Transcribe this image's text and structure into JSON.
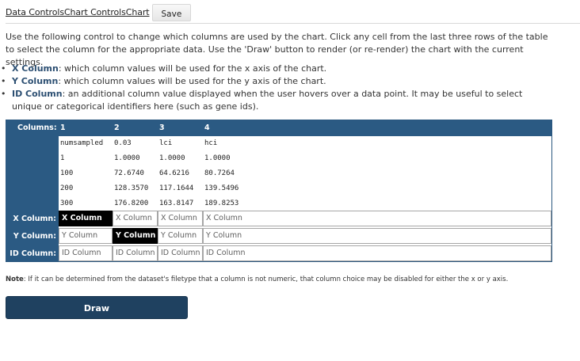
{
  "header": {
    "tab_label": "Data ControlsChart ControlsChart",
    "save_label": "Save"
  },
  "intro": "Use the following control to change which columns are used by the chart. Click any cell from the last three rows of the table to select the column for the appropriate data. Use the 'Draw' button to render (or re-render) the chart with the current settings.",
  "definitions": [
    {
      "term": "X Column",
      "text": ": which column values will be used for the x axis of the chart."
    },
    {
      "term": "Y Column",
      "text": ": which column values will be used for the y axis of the chart."
    },
    {
      "term": "ID Column",
      "text": ": an additional column value displayed when the user hovers over a data point. It may be useful to select unique or categorical identifiers here (such as gene ids)."
    }
  ],
  "table": {
    "columns_label": "Columns:",
    "column_numbers": [
      "1",
      "2",
      "3",
      "4"
    ],
    "data_rows": [
      [
        "numsampled",
        "0.03",
        "lci",
        "hci"
      ],
      [
        "1",
        "1.0000",
        "1.0000",
        "1.0000"
      ],
      [
        "100",
        "72.6740",
        "64.6216",
        "80.7264"
      ],
      [
        "200",
        "128.3570",
        "117.1644",
        "139.5496"
      ],
      [
        "300",
        "176.8200",
        "163.8147",
        "189.8253"
      ]
    ],
    "x_row": {
      "label": "X Column:",
      "cells": [
        "X Column",
        "X Column",
        "X Column",
        "X Column"
      ],
      "selected": 0
    },
    "y_row": {
      "label": "Y Column:",
      "cells": [
        "Y Column",
        "Y Column",
        "Y Column",
        "Y Column"
      ],
      "selected": 1
    },
    "id_row": {
      "label": "ID Column:",
      "cells": [
        "ID Column",
        "ID Column",
        "ID Column",
        "ID Column"
      ],
      "selected": -1
    }
  },
  "note": {
    "label": "Note",
    "text": ": If it can be determined from the dataset's filetype that a column is not numeric, that column choice may be disabled for either the x or y axis."
  },
  "draw_label": "Draw",
  "colors": {
    "header_bg": "#2b5a83",
    "draw_button": "#1f4160",
    "selected_cell": "#000000"
  }
}
